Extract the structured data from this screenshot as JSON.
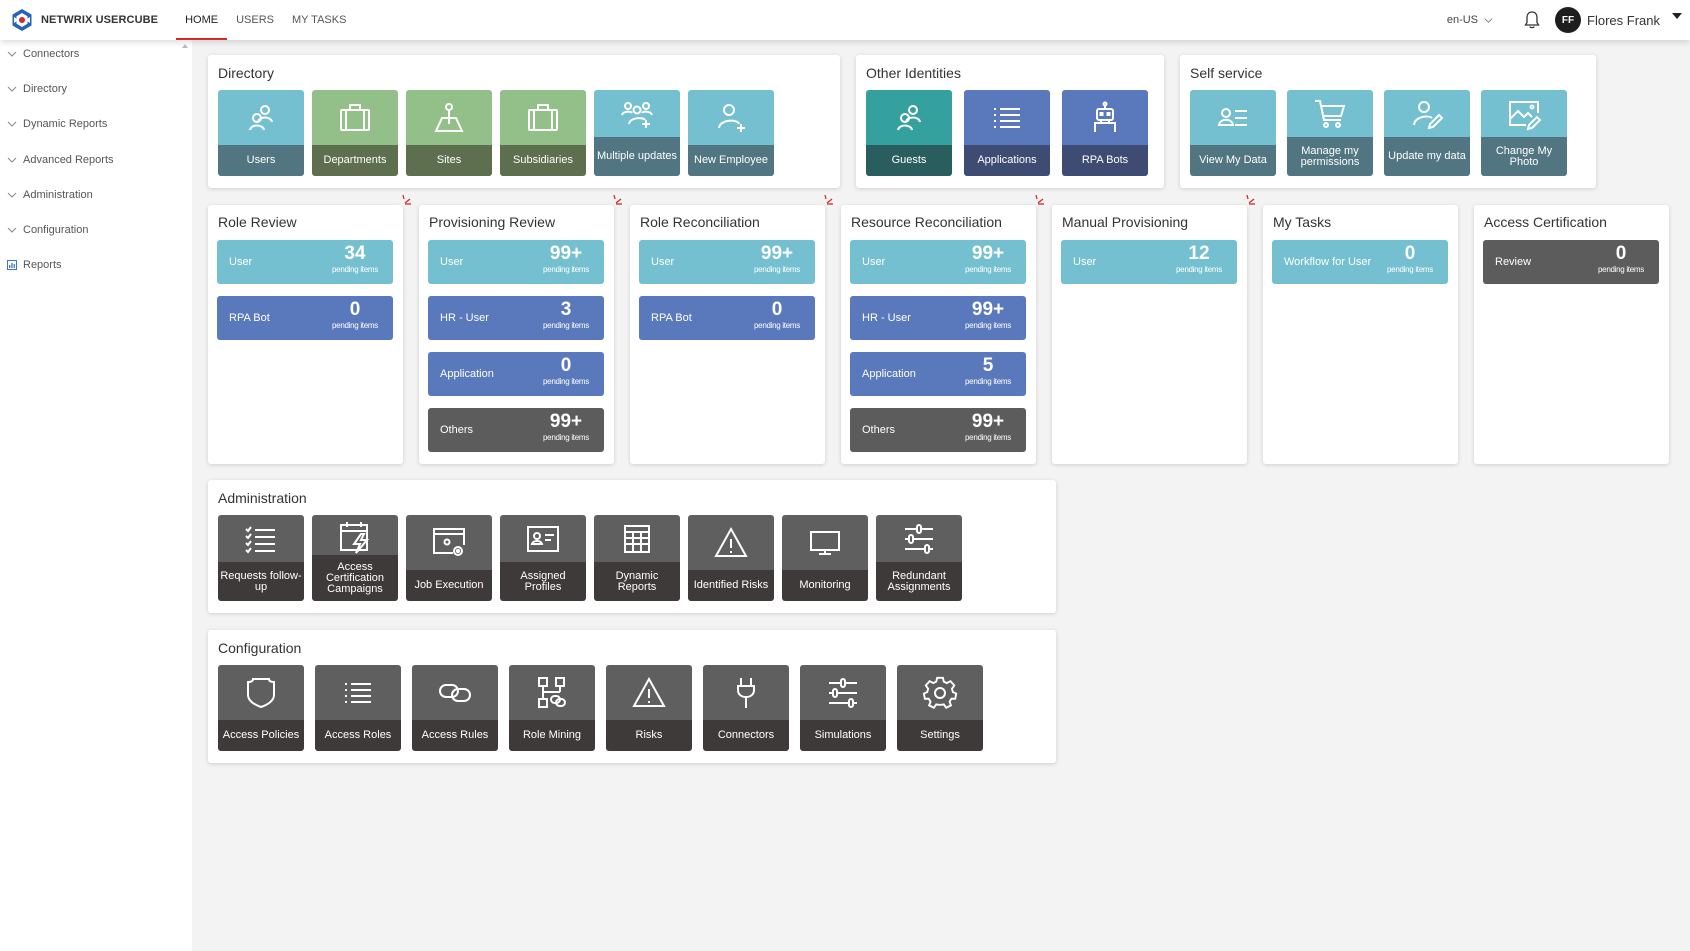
{
  "header": {
    "brand": "NETWRIX USERCUBE",
    "nav": [
      {
        "label": "HOME",
        "active": true
      },
      {
        "label": "USERS",
        "active": false
      },
      {
        "label": "MY TASKS",
        "active": false
      }
    ],
    "language": "en-US",
    "user": {
      "initials": "FF",
      "name": "Flores Frank"
    }
  },
  "sidebar": {
    "items": [
      {
        "label": "Connectors",
        "icon": "chevron-down-icon"
      },
      {
        "label": "Directory",
        "icon": "chevron-down-icon"
      },
      {
        "label": "Dynamic Reports",
        "icon": "chevron-down-icon"
      },
      {
        "label": "Advanced Reports",
        "icon": "chevron-down-icon"
      },
      {
        "label": "Administration",
        "icon": "chevron-down-icon"
      },
      {
        "label": "Configuration",
        "icon": "chevron-down-icon"
      },
      {
        "label": "Reports",
        "icon": "report-icon"
      }
    ]
  },
  "directory": {
    "title": "Directory",
    "tiles": [
      {
        "label": "Users",
        "icon": "users-icon",
        "color": "blue"
      },
      {
        "label": "Departments",
        "icon": "briefcase-icon",
        "color": "green"
      },
      {
        "label": "Sites",
        "icon": "map-pin-icon",
        "color": "green"
      },
      {
        "label": "Subsidiaries",
        "icon": "briefcase-icon",
        "color": "green"
      },
      {
        "label": "Multiple updates",
        "icon": "group-add-icon",
        "color": "blue"
      },
      {
        "label": "New Employee",
        "icon": "user-add-icon",
        "color": "blue"
      }
    ]
  },
  "other_identities": {
    "title": "Other Identities",
    "tiles": [
      {
        "label": "Guests",
        "icon": "users-icon",
        "color": "teal"
      },
      {
        "label": "Applications",
        "icon": "list-icon",
        "color": "indigo"
      },
      {
        "label": "RPA Bots",
        "icon": "robot-icon",
        "color": "indigo"
      }
    ]
  },
  "self_service": {
    "title": "Self service",
    "tiles": [
      {
        "label": "View My Data",
        "icon": "user-details-icon",
        "color": "blue"
      },
      {
        "label": "Manage my permissions",
        "icon": "cart-icon",
        "color": "blue"
      },
      {
        "label": "Update my data",
        "icon": "user-edit-icon",
        "color": "blue"
      },
      {
        "label": "Change My Photo",
        "icon": "image-edit-icon",
        "color": "blue"
      }
    ]
  },
  "review_cards": [
    {
      "title": "Role Review",
      "items": [
        {
          "label": "User",
          "count": "34",
          "sub": "pending items",
          "color": "blue"
        },
        {
          "label": "RPA Bot",
          "count": "0",
          "sub": "pending items",
          "color": "indigo"
        }
      ]
    },
    {
      "title": "Provisioning Review",
      "items": [
        {
          "label": "User",
          "count": "99+",
          "sub": "pending items",
          "color": "blue"
        },
        {
          "label": "HR - User",
          "count": "3",
          "sub": "pending items",
          "color": "indigo"
        },
        {
          "label": "Application",
          "count": "0",
          "sub": "pending items",
          "color": "indigo"
        },
        {
          "label": "Others",
          "count": "99+",
          "sub": "pending items",
          "color": "dark"
        }
      ]
    },
    {
      "title": "Role Reconciliation",
      "items": [
        {
          "label": "User",
          "count": "99+",
          "sub": "pending items",
          "color": "blue"
        },
        {
          "label": "RPA Bot",
          "count": "0",
          "sub": "pending items",
          "color": "indigo"
        }
      ]
    },
    {
      "title": "Resource Reconciliation",
      "items": [
        {
          "label": "User",
          "count": "99+",
          "sub": "pending items",
          "color": "blue"
        },
        {
          "label": "HR - User",
          "count": "99+",
          "sub": "pending items",
          "color": "indigo"
        },
        {
          "label": "Application",
          "count": "5",
          "sub": "pending items",
          "color": "indigo"
        },
        {
          "label": "Others",
          "count": "99+",
          "sub": "pending items",
          "color": "dark"
        }
      ]
    },
    {
      "title": "Manual Provisioning",
      "items": [
        {
          "label": "User",
          "count": "12",
          "sub": "pending items",
          "color": "blue"
        }
      ]
    },
    {
      "title": "My Tasks",
      "items": [
        {
          "label": "Workflow for User",
          "count": "0",
          "sub": "pending items",
          "color": "blue"
        }
      ]
    },
    {
      "title": "Access Certification",
      "items": [
        {
          "label": "Review",
          "count": "0",
          "sub": "pending items",
          "color": "dark"
        }
      ]
    }
  ],
  "administration": {
    "title": "Administration",
    "tiles": [
      {
        "label": "Requests follow-up",
        "icon": "checklist-icon"
      },
      {
        "label": "Access Certification Campaigns",
        "icon": "calendar-bolt-icon"
      },
      {
        "label": "Job Execution",
        "icon": "window-gears-icon"
      },
      {
        "label": "Assigned Profiles",
        "icon": "id-card-icon"
      },
      {
        "label": "Dynamic Reports",
        "icon": "table-icon"
      },
      {
        "label": "Identified Risks",
        "icon": "warning-icon"
      },
      {
        "label": "Monitoring",
        "icon": "monitor-icon"
      },
      {
        "label": "Redundant Assignments",
        "icon": "sliders-icon"
      }
    ]
  },
  "configuration": {
    "title": "Configuration",
    "tiles": [
      {
        "label": "Access Policies",
        "icon": "shield-icon"
      },
      {
        "label": "Access Roles",
        "icon": "list-icon"
      },
      {
        "label": "Access Rules",
        "icon": "link-icon"
      },
      {
        "label": "Role Mining",
        "icon": "hierarchy-icon"
      },
      {
        "label": "Risks",
        "icon": "warning-icon"
      },
      {
        "label": "Connectors",
        "icon": "plug-icon"
      },
      {
        "label": "Simulations",
        "icon": "sliders-icon"
      },
      {
        "label": "Settings",
        "icon": "gear-icon"
      }
    ]
  },
  "colors": {
    "accent": "#d32a2a",
    "tile_blue": "#74c0d0",
    "tile_green": "#93c088",
    "tile_teal": "#35a19e",
    "tile_indigo": "#5a79bd",
    "tile_dark": "#5f5f5f"
  }
}
